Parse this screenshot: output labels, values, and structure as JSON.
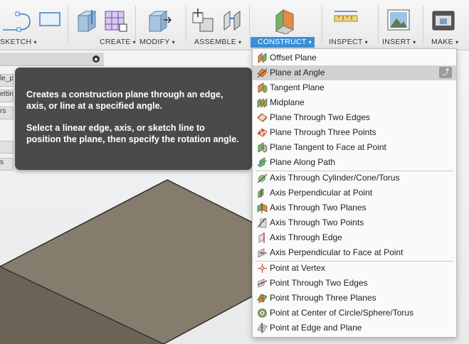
{
  "toolbar": {
    "sketch_label": "SKETCH",
    "create_label": "CREATE",
    "modify_label": "MODIFY",
    "assemble_label": "ASSEMBLE",
    "construct_label": "CONSTRUCT",
    "inspect_label": "INSPECT",
    "insert_label": "INSERT",
    "make_label": "MAKE",
    "caret": "▾"
  },
  "browser": {
    "close_glyph": "●",
    "item_1": "le_p",
    "item_2": "ettin",
    "item_3": "rs",
    "item_4": "s"
  },
  "tooltip": {
    "line1": "Creates a construction plane through an edge, axis, or line at a specified angle.",
    "line2": "Select a linear edge, axis, or sketch line to position the plane, then specify the rotation angle."
  },
  "menu": {
    "items": [
      {
        "label": "Offset Plane",
        "icon": "offset-plane-icon"
      },
      {
        "label": "Plane at Angle",
        "icon": "plane-at-angle-icon"
      },
      {
        "label": "Tangent Plane",
        "icon": "tangent-plane-icon"
      },
      {
        "label": "Midplane",
        "icon": "midplane-icon"
      },
      {
        "label": "Plane Through Two Edges",
        "icon": "plane-two-edges-icon"
      },
      {
        "label": "Plane Through Three Points",
        "icon": "plane-three-points-icon"
      },
      {
        "label": "Plane Tangent to Face at Point",
        "icon": "plane-tangent-face-icon"
      },
      {
        "label": "Plane Along Path",
        "icon": "plane-along-path-icon"
      },
      {
        "label": "Axis Through Cylinder/Cone/Torus",
        "icon": "axis-cylinder-icon"
      },
      {
        "label": "Axis Perpendicular at Point",
        "icon": "axis-perpendicular-point-icon"
      },
      {
        "label": "Axis Through Two Planes",
        "icon": "axis-two-planes-icon"
      },
      {
        "label": "Axis Through Two Points",
        "icon": "axis-two-points-icon"
      },
      {
        "label": "Axis Through Edge",
        "icon": "axis-edge-icon"
      },
      {
        "label": "Axis Perpendicular to Face at Point",
        "icon": "axis-perpendicular-face-icon"
      },
      {
        "label": "Point at Vertex",
        "icon": "point-vertex-icon"
      },
      {
        "label": "Point Through Two Edges",
        "icon": "point-two-edges-icon"
      },
      {
        "label": "Point Through Three Planes",
        "icon": "point-three-planes-icon"
      },
      {
        "label": "Point at Center of Circle/Sphere/Torus",
        "icon": "point-center-icon"
      },
      {
        "label": "Point at Edge and Plane",
        "icon": "point-edge-plane-icon"
      }
    ],
    "submenu_glyph": "⤴"
  },
  "colors": {
    "accent": "#3d8fd8",
    "tooltip_bg": "#4a4a4a",
    "box_top": "#8a8070",
    "box_side": "#5e574b"
  }
}
